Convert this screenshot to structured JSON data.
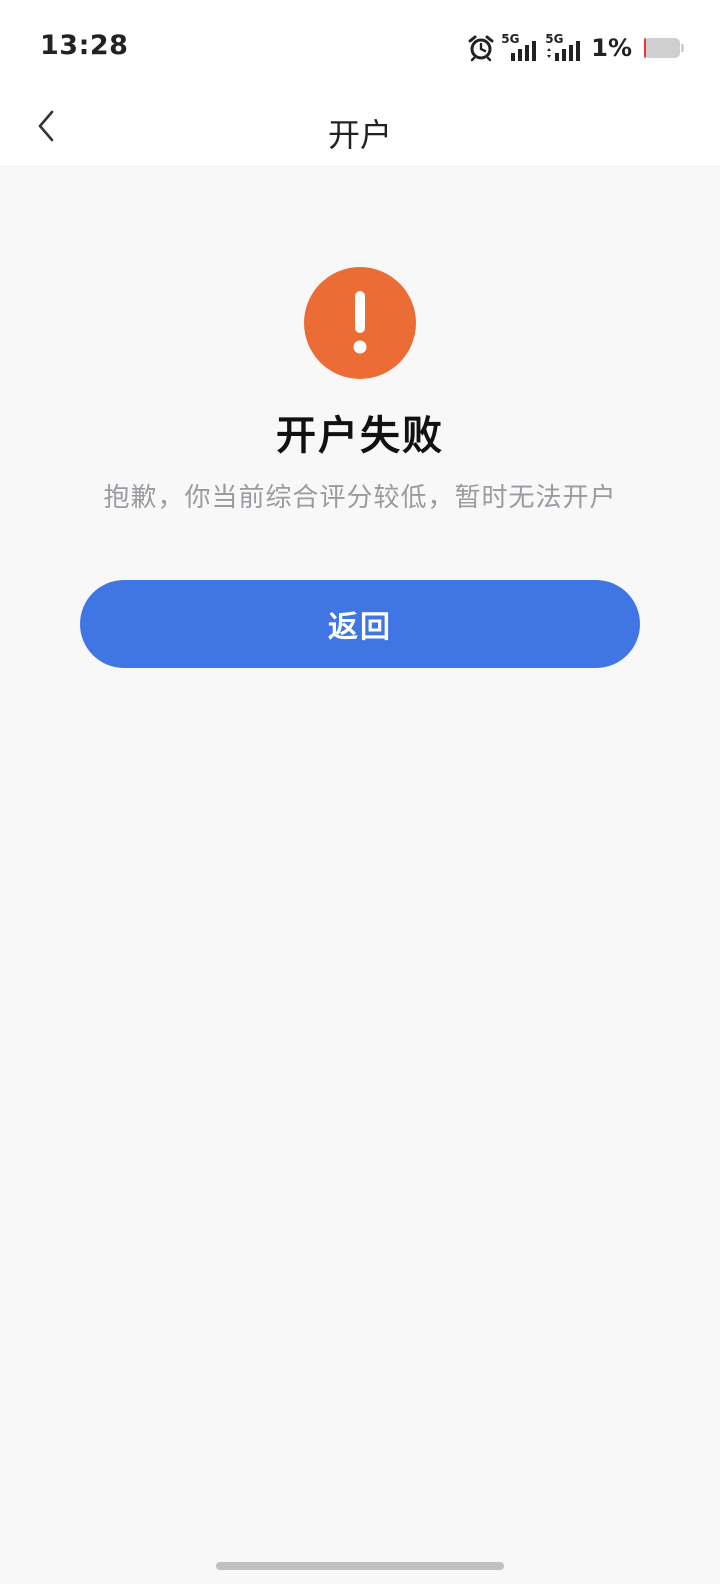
{
  "status_bar": {
    "time": "13:28",
    "network_1": "5G",
    "network_2": "5G",
    "battery_percent": "1%",
    "battery_level": 0.01,
    "icons": [
      "alarm-icon",
      "signal-5g-icon",
      "signal-5g-icon",
      "battery-icon"
    ]
  },
  "nav": {
    "title": "开户",
    "back_icon": "chevron-left-icon"
  },
  "result": {
    "icon": "warning-exclamation-icon",
    "icon_color": "#ec6c35",
    "title": "开户失败",
    "description": "抱歉，你当前综合评分较低，暂时无法开户"
  },
  "actions": {
    "return_label": "返回",
    "accent_color": "#3f76e4"
  }
}
